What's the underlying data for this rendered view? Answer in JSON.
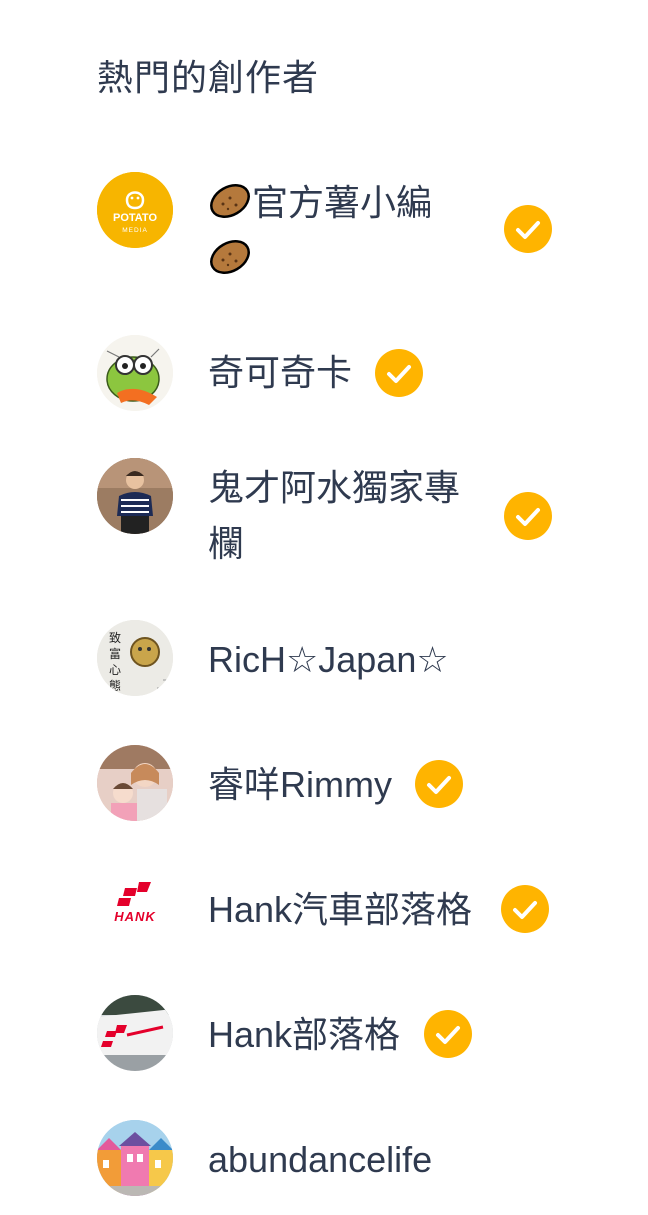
{
  "section": {
    "title": "熱門的創作者"
  },
  "colors": {
    "text": "#2f3a4f",
    "verified": "#ffb400",
    "potato_brand": "#f7b500",
    "hank_brand": "#e4002b"
  },
  "creators": [
    {
      "name_prefix_emoji": "potato-emoji",
      "name": "官方薯小編",
      "name_suffix_emoji": "potato-emoji",
      "avatar": "potato-media-logo",
      "avatar_label_1": "POTATO",
      "avatar_label_2": "MEDIA",
      "verified": true
    },
    {
      "name": "奇可奇卡",
      "avatar": "cartoon-green-bird-avatar",
      "verified": true
    },
    {
      "name": "鬼才阿水獨家專欄",
      "avatar": "person-photo-avatar",
      "verified": true
    },
    {
      "name": "RicH☆Japan☆",
      "avatar": "book-cover-avatar",
      "avatar_text": "致富心態",
      "verified": false
    },
    {
      "name": "睿咩Rimmy",
      "avatar": "mother-child-photo-avatar",
      "verified": true
    },
    {
      "name": "Hank汽車部落格",
      "avatar": "hank-logo",
      "avatar_text": "HANK",
      "verified": true
    },
    {
      "name": "Hank部落格",
      "avatar": "hank-car-photo-avatar",
      "verified": true
    },
    {
      "name": "abundancelife",
      "avatar": "colorful-houses-avatar",
      "verified": false
    }
  ]
}
